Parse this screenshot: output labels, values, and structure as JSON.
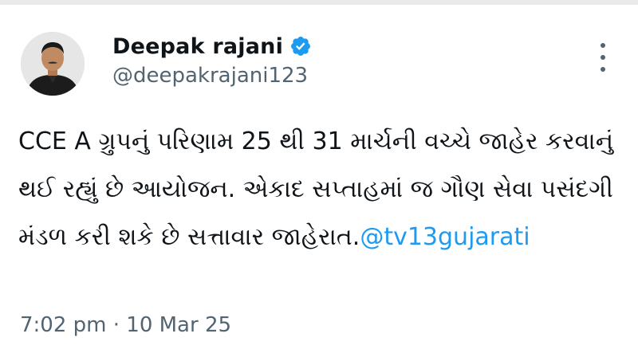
{
  "tweet": {
    "author": {
      "display_name": "Deepak rajani",
      "handle": "@deepakrajani123",
      "verified": true,
      "avatar_icon": "profile-photo",
      "verified_icon": "verified-badge-icon"
    },
    "text": "CCE A ગ્રુપનું પરિણામ 25 થી 31 માર્ચની વચ્ચે જાહેર કરવાનું થઈ રહ્યું છે આયોજન. એકાદ સપ્તાહમાં જ ગૌણ સેવા પસંદગી મંડળ કરી શકે છે સત્તાવાર જાહેરાત.",
    "mention": "@tv13gujarati",
    "timestamp": "7:02 pm · 10 Mar 25",
    "more_icon": "more-vertical-icon"
  },
  "colors": {
    "link": "#1d9bf0",
    "secondary_text": "#536471",
    "primary_text": "#0f1419",
    "verified_badge": "#1d9bf0"
  }
}
